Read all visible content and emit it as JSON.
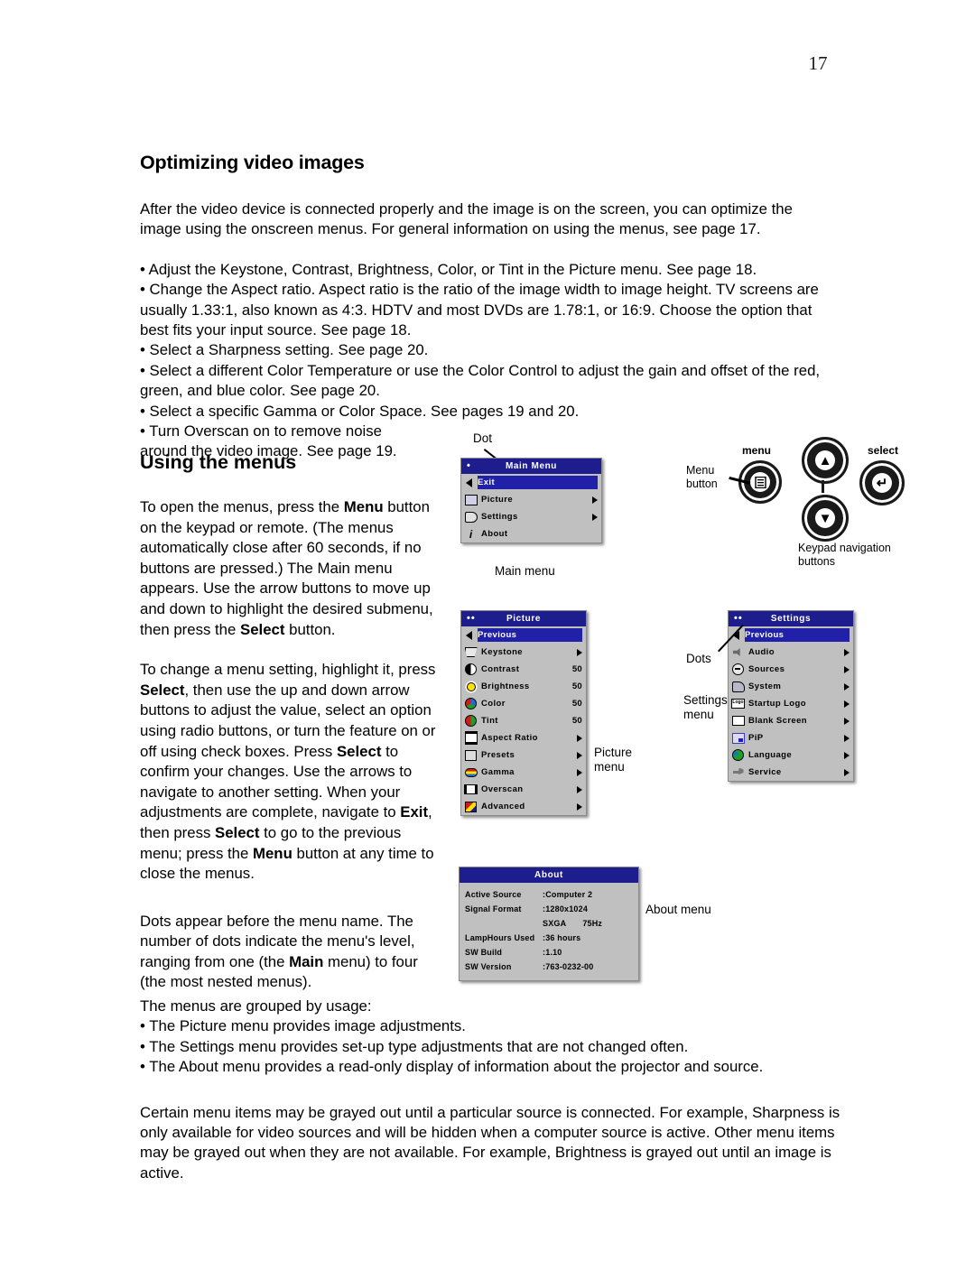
{
  "page": {
    "number": "17"
  },
  "section1": {
    "title": "Optimizing video images",
    "intro": "After the video device is connected properly and the image is on the screen, you can optimize the image using the onscreen menus. For general information on using the menus, see page 17.",
    "bullets": [
      "Adjust the Keystone, Contrast, Brightness, Color, or Tint in the Picture menu. See page 18.",
      "Change the Aspect ratio. Aspect ratio is the ratio of the image width to image height. TV screens are usually 1.33:1, also known as 4:3. HDTV and most DVDs are 1.78:1, or 16:9. Choose the option that best fits your input source. See page 18.",
      "Select a Sharpness setting. See page 20.",
      "Select a different Color Temperature or use the Color Control to adjust the gain and offset of the red, green, and blue color. See page 20.",
      "Select a specific Gamma or Color Space. See pages 19 and 20.",
      "Turn Overscan on to remove noise around the video image. See page 19."
    ]
  },
  "section2": {
    "title": "Using the menus",
    "para1_a": "To open the menus, press the ",
    "para1_b": "Menu",
    "para1_c": " button on the keypad or remote. (The menus automatically close after 60 seconds, if no buttons are pressed.) The Main menu appears. Use the arrow buttons to move up and down to highlight the desired submenu, then press the ",
    "para1_d": "Select",
    "para1_e": " button.",
    "para2_a": "To change a menu setting, highlight it, press ",
    "para2_b": "Select",
    "para2_c": ", then use the up and down arrow buttons to adjust the value, select an option using radio buttons, or turn the feature on or off using check boxes. Press ",
    "para2_d": "Select",
    "para2_e": " to confirm your changes. Use the arrows to navigate to another setting. When your adjustments are complete, navigate to ",
    "para2_f": "Exit",
    "para2_g": ", then press ",
    "para2_h": "Select",
    "para2_i": " to go to the previous menu; press the ",
    "para2_j": "Menu",
    "para2_k": " button at any time to close the menus.",
    "para3_a": "Dots appear before the menu name. The number of dots indicate the menu's level, ranging from one (the ",
    "para3_b": "Main",
    "para3_c": " menu) to four (the most nested menus)."
  },
  "section3": {
    "lead": "The menus are grouped by usage:",
    "bullets": [
      "The Picture menu provides image adjustments.",
      "The Settings menu provides set-up type adjustments that are not changed often.",
      "The About menu provides a read-only display of information about the projector and source."
    ],
    "final": "Certain menu items may be grayed out until a particular source is connected. For example, Sharpness is only available for video sources and will be hidden when a computer source is active. Other menu items may be grayed out when they are not available. For example, Brightness is grayed out until an image is active."
  },
  "main_menu": {
    "dots": "•",
    "title": "Main Menu",
    "items": [
      {
        "label": "Exit",
        "icon": "back-arrow-icon",
        "highlight": true,
        "arrow": false
      },
      {
        "label": "Picture",
        "icon": "picture-icon",
        "highlight": false,
        "arrow": true
      },
      {
        "label": "Settings",
        "icon": "settings-icon",
        "highlight": false,
        "arrow": true
      },
      {
        "label": "About",
        "icon": "info-icon",
        "highlight": false,
        "arrow": false
      }
    ],
    "caption": "Main menu",
    "dot_callout": "Dot"
  },
  "picture_menu": {
    "dots": "••",
    "title": "Picture",
    "items": [
      {
        "label": "Previous",
        "icon": "back-arrow-icon",
        "highlight": true,
        "value": "",
        "arrow": false
      },
      {
        "label": "Keystone",
        "icon": "keystone-icon",
        "highlight": false,
        "value": "",
        "arrow": true
      },
      {
        "label": "Contrast",
        "icon": "contrast-icon",
        "highlight": false,
        "value": "50",
        "arrow": false
      },
      {
        "label": "Brightness",
        "icon": "brightness-icon",
        "highlight": false,
        "value": "50",
        "arrow": false
      },
      {
        "label": "Color",
        "icon": "color-icon",
        "highlight": false,
        "value": "50",
        "arrow": false
      },
      {
        "label": "Tint",
        "icon": "tint-icon",
        "highlight": false,
        "value": "50",
        "arrow": false
      },
      {
        "label": "Aspect Ratio",
        "icon": "aspect-ratio-icon",
        "highlight": false,
        "value": "",
        "arrow": true
      },
      {
        "label": "Presets",
        "icon": "presets-icon",
        "highlight": false,
        "value": "",
        "arrow": true
      },
      {
        "label": "Gamma",
        "icon": "gamma-icon",
        "highlight": false,
        "value": "",
        "arrow": true
      },
      {
        "label": "Overscan",
        "icon": "overscan-icon",
        "highlight": false,
        "value": "",
        "arrow": true
      },
      {
        "label": "Advanced",
        "icon": "advanced-icon",
        "highlight": false,
        "value": "",
        "arrow": true
      }
    ],
    "caption_line1": "Picture",
    "caption_line2": "menu"
  },
  "settings_menu": {
    "dots": "••",
    "title": "Settings",
    "items": [
      {
        "label": "Previous",
        "icon": "back-arrow-icon",
        "highlight": true,
        "arrow": false
      },
      {
        "label": "Audio",
        "icon": "audio-icon",
        "highlight": false,
        "arrow": true
      },
      {
        "label": "Sources",
        "icon": "sources-icon",
        "highlight": false,
        "arrow": true
      },
      {
        "label": "System",
        "icon": "system-icon",
        "highlight": false,
        "arrow": true
      },
      {
        "label": "Startup Logo",
        "icon": "startup-logo-icon",
        "highlight": false,
        "arrow": true
      },
      {
        "label": "Blank Screen",
        "icon": "blank-screen-icon",
        "highlight": false,
        "arrow": true
      },
      {
        "label": "PiP",
        "icon": "pip-icon",
        "highlight": false,
        "arrow": true
      },
      {
        "label": "Language",
        "icon": "language-icon",
        "highlight": false,
        "arrow": true
      },
      {
        "label": "Service",
        "icon": "service-icon",
        "highlight": false,
        "arrow": true
      }
    ],
    "caption_line1": "Settings",
    "caption_line2": "menu",
    "dots_callout": "Dots"
  },
  "about_menu": {
    "title": "About",
    "rows": [
      {
        "key": "Active Source",
        "value": ":Computer 2",
        "extra": ""
      },
      {
        "key": "Signal Format",
        "value": ":1280x1024 SXGA",
        "extra": "75Hz"
      },
      {
        "key": "LampHours Used",
        "value": ":36 hours",
        "extra": ""
      },
      {
        "key": "SW Build",
        "value": ":1.10",
        "extra": ""
      },
      {
        "key": "SW Version",
        "value": ":763-0232-00",
        "extra": ""
      }
    ],
    "caption": "About menu"
  },
  "keypad": {
    "menu_label": "menu",
    "select_label": "select",
    "menu_button_caption_line1": "Menu",
    "menu_button_caption_line2": "button",
    "nav_caption_line1": "Keypad navigation",
    "nav_caption_line2": "buttons"
  }
}
